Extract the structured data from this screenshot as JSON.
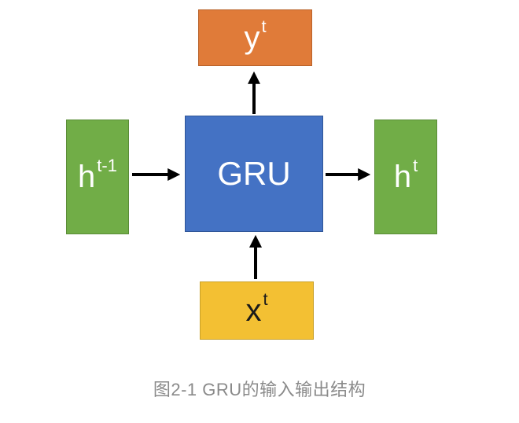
{
  "diagram": {
    "nodes": {
      "h_prev": {
        "base": "h",
        "sup": "t-1"
      },
      "gru": {
        "label": "GRU"
      },
      "h_next": {
        "base": "h",
        "sup": "t"
      },
      "y": {
        "base": "y",
        "sup": "t"
      },
      "x": {
        "base": "x",
        "sup": "t"
      }
    },
    "colors": {
      "hidden_state": "#71ad47",
      "gru_cell": "#4472c4",
      "output": "#e07b39",
      "input": "#f3c033",
      "arrow": "#000000",
      "caption": "#8a8a8a"
    }
  },
  "caption": "图2-1 GRU的输入输出结构"
}
